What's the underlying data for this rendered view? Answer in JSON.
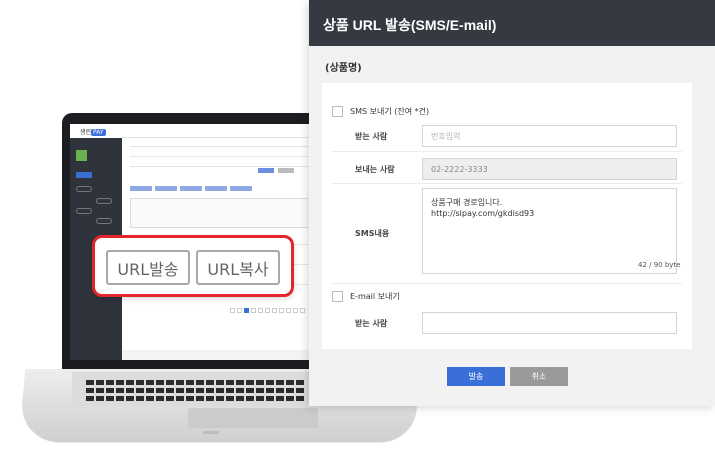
{
  "modal": {
    "title": "상품 URL 발송(SMS/E-mail)",
    "product_name": "(상품명)",
    "sms_checkbox_label": "SMS 보내기 (잔여 *건)",
    "receiver_label": "받는 사람",
    "receiver_placeholder": "번호입력",
    "sender_label": "보내는 사람",
    "sender_value": "02-2222-3333",
    "sms_content_label": "SMS내용",
    "sms_content_value": "상품구매 경로입니다.\nhttp://slpay.com/gkdisd93",
    "sms_counter": "42 / 90 byte",
    "email_checkbox_label": "E-mail 보내기",
    "email_receiver_label": "받는 사람",
    "email_receiver_value": "",
    "send_button": "발송",
    "cancel_button": "취소"
  },
  "callout": {
    "url_send_button": "URL발송",
    "url_copy_button": "URL복사"
  },
  "laptop_screen": {
    "logo_text": "생린",
    "logo_badge": "PAY"
  },
  "colors": {
    "header_bg": "#353a42",
    "primary": "#3b6fd8",
    "cancel": "#9a9a9a",
    "callout_border": "#e4252b"
  }
}
